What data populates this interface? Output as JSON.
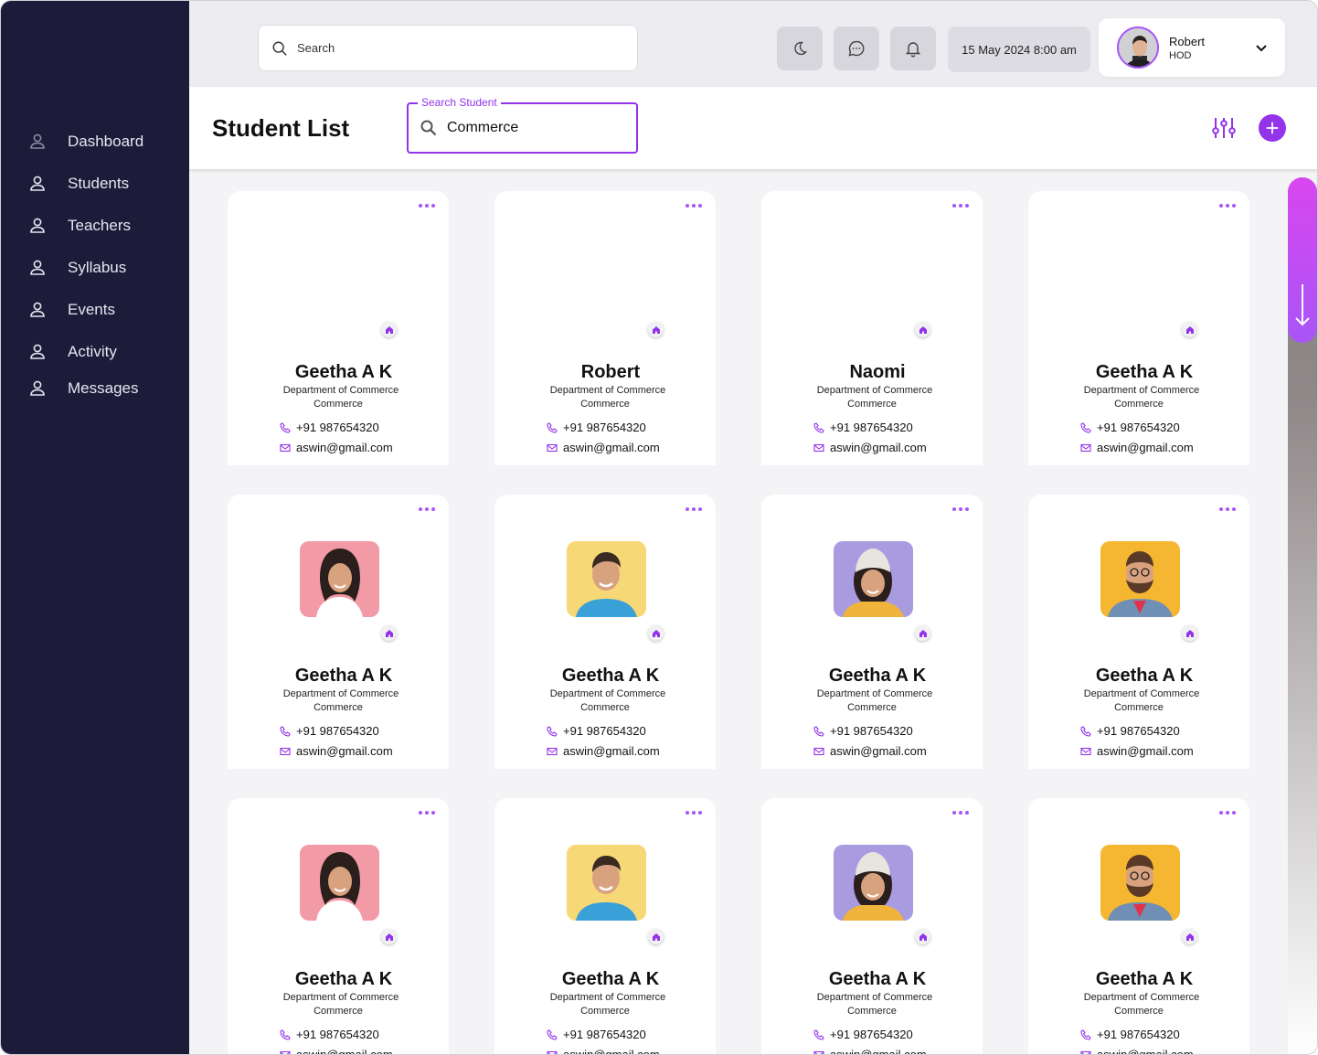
{
  "sidebar": {
    "items": [
      {
        "label": "Dashboard",
        "icon": "user-icon"
      },
      {
        "label": "Students",
        "icon": "user-icon"
      },
      {
        "label": "Teachers",
        "icon": "user-icon"
      },
      {
        "label": "Syllabus",
        "icon": "user-icon"
      },
      {
        "label": "Events",
        "icon": "user-icon"
      },
      {
        "label": "Activity",
        "icon": "user-icon"
      },
      {
        "label": "Messages",
        "icon": "user-icon"
      }
    ]
  },
  "topbar": {
    "search_placeholder": "Search",
    "datetime": "15 May 2024 8:00 am",
    "user": {
      "name": "Robert",
      "role": "HOD"
    }
  },
  "header": {
    "title": "Student List",
    "search_label": "Search Student",
    "search_value": "Commerce"
  },
  "colors": {
    "sidebar": "#1d1b3a",
    "accent": "#9333ea",
    "accent_light": "#a855f7"
  },
  "cards": [
    {
      "name": "Geetha A K",
      "dept": "Department of Commerce",
      "major": "Commerce",
      "phone": "+91 987654320",
      "email": "aswin@gmail.com",
      "photo": "none"
    },
    {
      "name": "Robert",
      "dept": "Department of Commerce",
      "major": "Commerce",
      "phone": "+91 987654320",
      "email": "aswin@gmail.com",
      "photo": "none"
    },
    {
      "name": "Naomi",
      "dept": "Department of Commerce",
      "major": "Commerce",
      "phone": "+91 987654320",
      "email": "aswin@gmail.com",
      "photo": "none"
    },
    {
      "name": "Geetha A K",
      "dept": "Department of Commerce",
      "major": "Commerce",
      "phone": "+91 987654320",
      "email": "aswin@gmail.com",
      "photo": "none"
    },
    {
      "name": "Geetha A K",
      "dept": "Department of Commerce",
      "major": "Commerce",
      "phone": "+91 987654320",
      "email": "aswin@gmail.com",
      "photo": "woman-pink"
    },
    {
      "name": "Geetha A K",
      "dept": "Department of Commerce",
      "major": "Commerce",
      "phone": "+91 987654320",
      "email": "aswin@gmail.com",
      "photo": "man-yellow"
    },
    {
      "name": "Geetha A K",
      "dept": "Department of Commerce",
      "major": "Commerce",
      "phone": "+91 987654320",
      "email": "aswin@gmail.com",
      "photo": "woman-purple"
    },
    {
      "name": "Geetha A K",
      "dept": "Department of Commerce",
      "major": "Commerce",
      "phone": "+91 987654320",
      "email": "aswin@gmail.com",
      "photo": "man-orange"
    },
    {
      "name": "Geetha A K",
      "dept": "Department of Commerce",
      "major": "Commerce",
      "phone": "+91 987654320",
      "email": "aswin@gmail.com",
      "photo": "woman-pink"
    },
    {
      "name": "Geetha A K",
      "dept": "Department of Commerce",
      "major": "Commerce",
      "phone": "+91 987654320",
      "email": "aswin@gmail.com",
      "photo": "man-yellow"
    },
    {
      "name": "Geetha A K",
      "dept": "Department of Commerce",
      "major": "Commerce",
      "phone": "+91 987654320",
      "email": "aswin@gmail.com",
      "photo": "woman-purple"
    },
    {
      "name": "Geetha A K",
      "dept": "Department of Commerce",
      "major": "Commerce",
      "phone": "+91 987654320",
      "email": "aswin@gmail.com",
      "photo": "man-orange"
    }
  ]
}
